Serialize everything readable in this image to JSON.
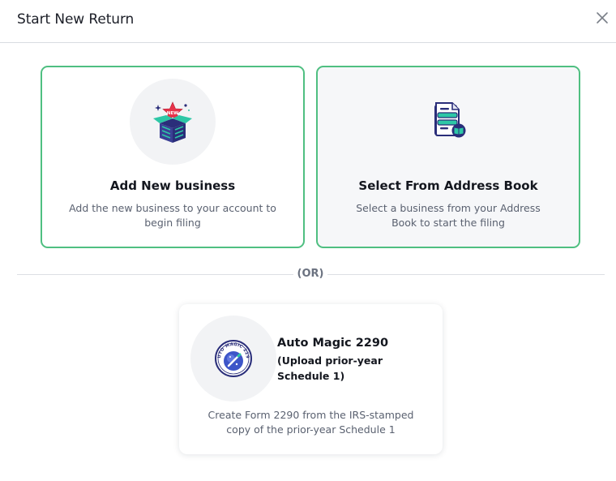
{
  "header": {
    "title": "Start New Return"
  },
  "options": {
    "add_new": {
      "title": "Add New business",
      "description": "Add the new business to your account to begin filing",
      "badge": "NEW",
      "icon": "new-business-box-icon"
    },
    "address_book": {
      "title": "Select From Address Book",
      "description": "Select a business from your Address Book to start the filing",
      "icon": "address-book-document-icon"
    }
  },
  "separator": {
    "label": "(OR)"
  },
  "auto_magic": {
    "title": "Auto Magic 2290",
    "subtitle": "(Upload prior-year Schedule 1)",
    "description": "Create Form 2290 from the IRS-stamped copy of the prior-year Schedule 1",
    "badge_text": "AUTO MAGIC 2290",
    "icon": "auto-magic-badge-icon"
  },
  "colors": {
    "accent_green": "#4fbf81",
    "navy": "#2a2e7a",
    "teal": "#2dc7a6",
    "red": "#e8334a"
  }
}
